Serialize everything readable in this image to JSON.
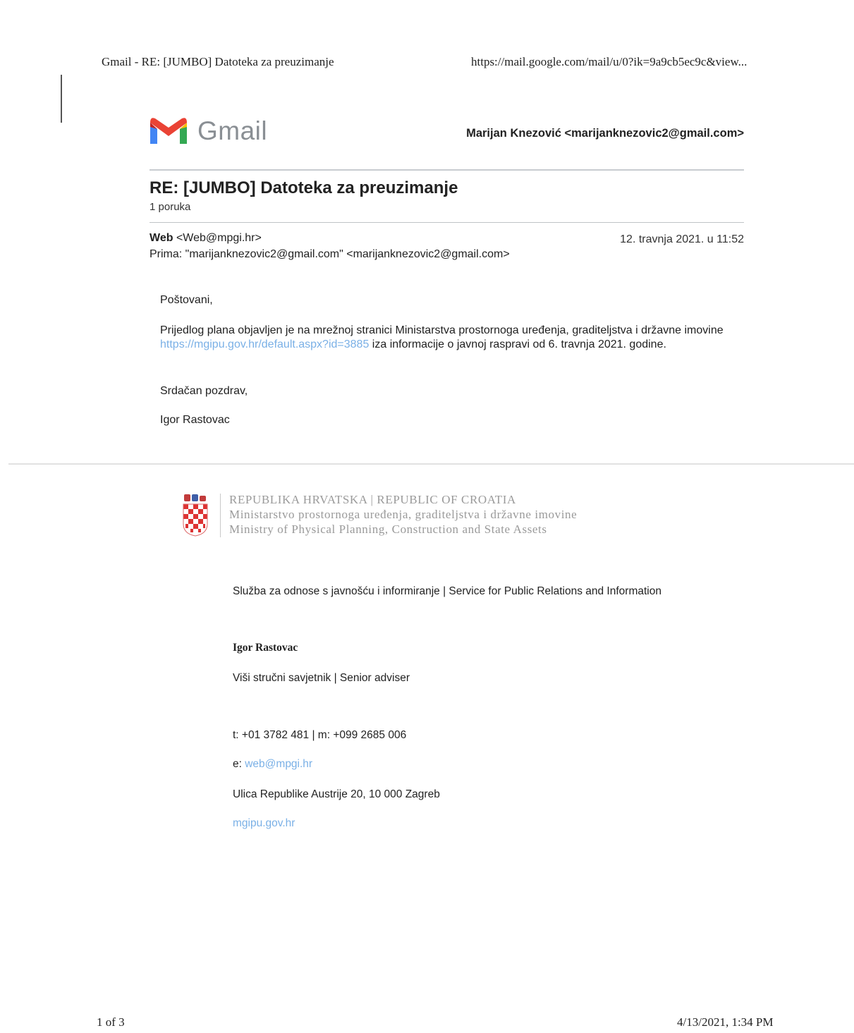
{
  "print_header": {
    "title": "Gmail - RE: [JUMBO] Datoteka za preuzimanje",
    "url": "https://mail.google.com/mail/u/0?ik=9a9cb5ec9c&view..."
  },
  "gmail": {
    "logo_text": "Gmail",
    "account": "Marijan Knezović <marijanknezovic2@gmail.com>"
  },
  "thread": {
    "subject": "RE: [JUMBO] Datoteka za preuzimanje",
    "message_count": "1 poruka"
  },
  "message": {
    "sender_name": "Web",
    "sender_email": "<Web@mpgi.hr>",
    "date": "12. travnja 2021. u 11:52",
    "recipient": "Prima: \"marijanknezovic2@gmail.com\" <marijanknezovic2@gmail.com>",
    "greeting": "Poštovani,",
    "para_before_link": "Prijedlog plana objavljen je na mrežnoj stranici Ministarstva prostornoga uređenja, graditeljstva i državne imovine ",
    "para_link": "https://mgipu.gov.hr/default.aspx?id=3885",
    "para_after_link": " iza informacije o javnoj raspravi od 6. travnja 2021. godine.",
    "closing": "Srdačan pozdrav,",
    "signer": "Igor Rastovac"
  },
  "signature": {
    "ministry_line1": "REPUBLIKA HRVATSKA  |  REPUBLIC OF CROATIA",
    "ministry_line2": "Ministarstvo prostornoga uređenja, graditeljstva i državne imovine",
    "ministry_line3": "Ministry of Physical Planning, Construction and State Assets",
    "service": "Služba za odnose s javnošću i informiranje | Service for Public Relations and Information",
    "name": "Igor Rastovac",
    "title": "Viši stručni savjetnik | Senior adviser",
    "phone": "t: +01 3782 481  | m: +099 2685 006",
    "email_label": "e: ",
    "email": "web@mpgi.hr",
    "address": "Ulica Republike Austrije 20, 10 000 Zagreb",
    "website": "mgipu.gov.hr"
  },
  "print_footer": {
    "page": "1 of 3",
    "datetime": "4/13/2021, 1:34 PM"
  },
  "colors": {
    "link": "#7ab0e6",
    "gmail_red": "#ea4335",
    "gmail_blue": "#4285f4",
    "gmail_green": "#34a853",
    "gmail_yellow": "#fbbc04"
  }
}
